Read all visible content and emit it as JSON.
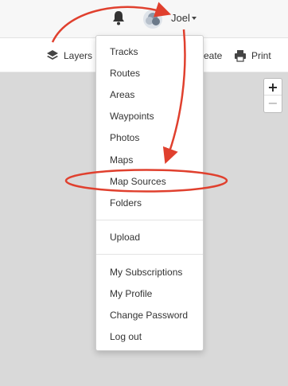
{
  "topbar": {
    "notifications_icon": "bell-icon",
    "avatar_icon": "user-avatar",
    "user_name": "Joel"
  },
  "toolbar": {
    "layers_label": "Layers",
    "layers_icon": "layers-icon",
    "create_label_visible": "eate",
    "print_label": "Print",
    "print_icon": "printer-icon"
  },
  "map_controls": {
    "zoom_in_label": "+",
    "zoom_out_label": "−"
  },
  "user_menu": {
    "groups": [
      [
        "Tracks",
        "Routes",
        "Areas",
        "Waypoints",
        "Photos",
        "Maps",
        "Map Sources",
        "Folders"
      ],
      [
        "Upload"
      ],
      [
        "My Subscriptions",
        "My Profile",
        "Change Password",
        "Log out"
      ]
    ]
  },
  "annotation": {
    "highlighted_item": "Map Sources",
    "color": "#e0402e"
  },
  "colors": {
    "background": "#d9d9d9",
    "topbar": "#f7f7f7",
    "menu": "#ffffff"
  }
}
